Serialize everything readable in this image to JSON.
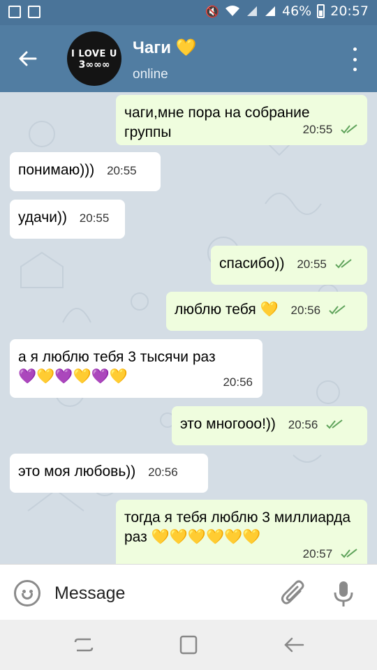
{
  "status_bar": {
    "battery": "46%",
    "time": "20:57"
  },
  "header": {
    "avatar_text_top": "I LOVE U",
    "avatar_text_bottom": "3∞∞∞",
    "title": "Чаги 💛",
    "status": "online"
  },
  "messages": [
    {
      "dir": "out",
      "text": "чаги,мне пора на собрание группы",
      "time": "20:55"
    },
    {
      "dir": "in",
      "text": "понимаю)))",
      "time": "20:55"
    },
    {
      "dir": "in",
      "text": "удачи))",
      "time": "20:55"
    },
    {
      "dir": "out",
      "text": "спасибо))",
      "time": "20:55"
    },
    {
      "dir": "out",
      "text": "люблю тебя 💛",
      "time": "20:56"
    },
    {
      "dir": "in",
      "text": "а я люблю тебя 3 тысячи раз 💜💛💜💛💜💛",
      "time": "20:56"
    },
    {
      "dir": "out",
      "text": "это многооо!))",
      "time": "20:56"
    },
    {
      "dir": "in",
      "text": "это моя любовь))",
      "time": "20:56"
    },
    {
      "dir": "out",
      "text": "тогда я тебя люблю 3 миллиарда раз 💛💛💛💛💛💛",
      "time": "20:57"
    }
  ],
  "composer": {
    "placeholder": "Message"
  },
  "icons": {
    "back": "arrow-left-icon",
    "menu": "more-vert-icon",
    "emoji": "emoji-icon",
    "attach": "paperclip-icon",
    "mic": "microphone-icon",
    "recents": "recents-icon",
    "home": "home-icon",
    "nav_back": "back-icon"
  },
  "colors": {
    "header_bg": "#517da2",
    "incoming_bubble": "#ffffff",
    "outgoing_bubble": "#effdde",
    "read_ticks": "#5fa35b"
  }
}
